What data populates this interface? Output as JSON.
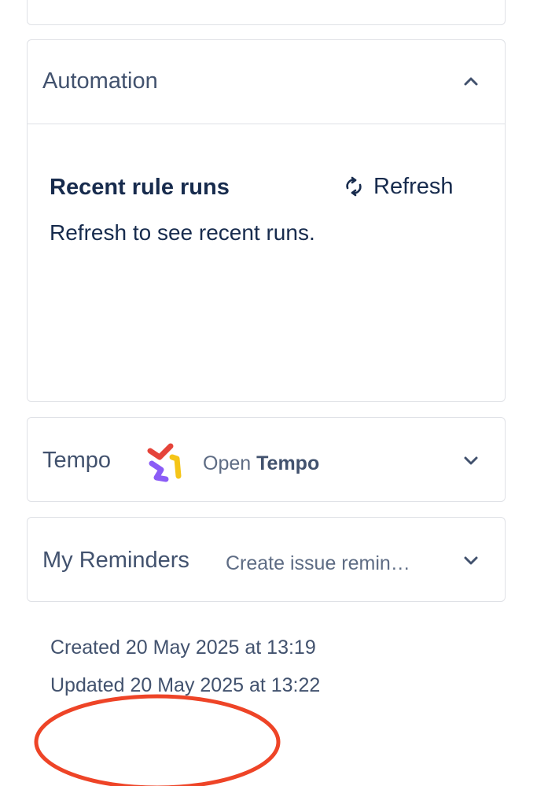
{
  "automation": {
    "title": "Automation",
    "recent_runs_title": "Recent rule runs",
    "refresh_label": "Refresh",
    "empty_message": "Refresh to see recent runs."
  },
  "tempo": {
    "title": "Tempo",
    "open_prefix": "Open",
    "open_app": "Tempo"
  },
  "reminders": {
    "title": "My Reminders",
    "create_label": "Create issue remin…"
  },
  "meta": {
    "created": "Created 20 May 2025 at 13:19",
    "updated": "Updated 20 May 2025 at 13:22"
  },
  "icons": {
    "collapse": "chevron-up-icon",
    "expand": "chevron-down-icon",
    "refresh": "refresh-icon",
    "tempo_logo": "tempo-logo",
    "annotation": "red-ellipse-annotation"
  },
  "colors": {
    "text_primary": "#172b4d",
    "text_secondary": "#42526e",
    "text_subtle": "#5e6c84",
    "border": "#dfe1e6",
    "annotation": "#ee4427"
  }
}
